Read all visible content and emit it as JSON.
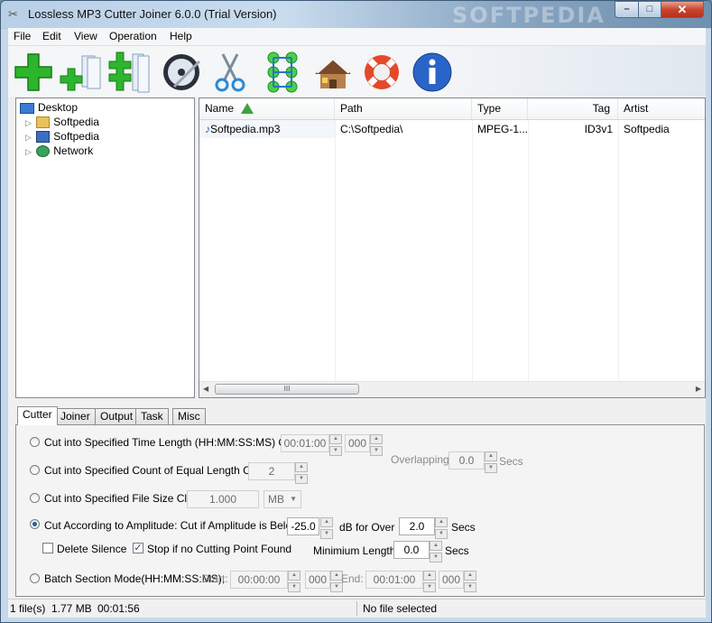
{
  "window": {
    "title": "Lossless MP3 Cutter Joiner 6.0.0 (Trial Version)",
    "watermark": "SOFTPEDIA",
    "min": "–",
    "max": "□",
    "close": "✕"
  },
  "menu": [
    "File",
    "Edit",
    "View",
    "Operation",
    "Help"
  ],
  "toolbar": [
    "add-file-icon",
    "add-files-icon",
    "add-folder-icon",
    "play-disc-icon",
    "cut-icon",
    "join-icon",
    "home-icon",
    "help-lifebuoy-icon",
    "info-icon"
  ],
  "tree": {
    "root": "Desktop",
    "items": [
      "Softpedia",
      "Softpedia",
      "Network"
    ]
  },
  "list": {
    "columns": [
      "Name",
      "Path",
      "Type",
      "Tag",
      "Artist"
    ],
    "rows": [
      {
        "name": "Softpedia.mp3",
        "path": "C:\\Softpedia\\",
        "type": "MPEG-1...",
        "tag": "ID3v1",
        "artist": "Softpedia"
      }
    ],
    "scroll_grip": "III"
  },
  "tabs": [
    "Cutter",
    "Joiner",
    "Output",
    "Task",
    "Misc"
  ],
  "cutter": {
    "opt_time": "Cut into Specified Time Length (HH:MM:SS:MS) Clips:",
    "time_value": "00:01:00",
    "time_ms": "000",
    "opt_count": "Cut into Specified Count of Equal Length Clips:",
    "count_value": "2",
    "overlapping_label": "Overlapping:",
    "overlapping_value": "0.0",
    "overlapping_unit": "Secs",
    "opt_size": "Cut into Specified File Size Clips:",
    "size_value": "1.000",
    "size_unit": "MB",
    "opt_amplitude": "Cut According to Amplitude: Cut if Amplitude is Below",
    "amplitude_value": "-25.0",
    "db_for_over": "dB  for Over",
    "over_value": "2.0",
    "over_unit": "Secs",
    "delete_silence": "Delete Silence",
    "stop_if": "Stop if no Cutting Point Found",
    "min_length_label": "Minimium Length:",
    "min_length_value": "0.0",
    "min_length_unit": "Secs",
    "opt_batch": "Batch Section Mode(HH:MM:SS:MS),",
    "start_label": "Start:",
    "start_value": "00:00:00",
    "start_ms": "000",
    "end_label": "End:",
    "end_value": "00:01:00",
    "end_ms": "000"
  },
  "status": {
    "files": "1 file(s)",
    "size": "1.77 MB",
    "duration": "00:01:56",
    "selection": "No file selected"
  },
  "colors": {
    "accent_blue": "#1c5fb0",
    "plus_green": "#2db52d"
  }
}
